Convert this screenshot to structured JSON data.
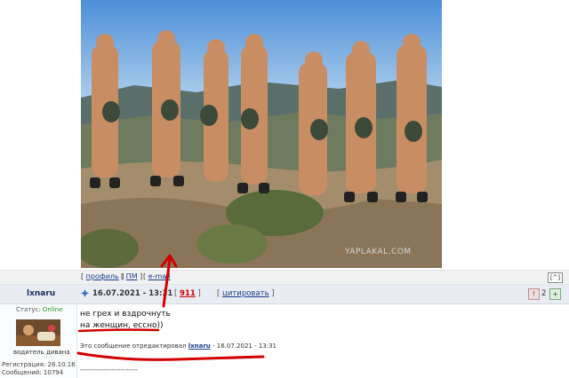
{
  "photo": {
    "watermark": "YAPLAKAL.COM"
  },
  "actions": {
    "profile": "профиль",
    "pm": "ПМ",
    "email": "e-mail",
    "scroll_top": "[^]"
  },
  "post": {
    "username": "lxnaru",
    "date": "16.07.2021 - 13:31",
    "number": "911",
    "quote_label": "цитировать",
    "reply_count": "2",
    "body_lines": [
      "не грех и вздрочнуть",
      "на женщин, ессно))"
    ],
    "edit_prefix": "Это сообщение отредактировал",
    "edit_user": "lxnaru",
    "edit_date": "- 16.07.2021 - 13:31",
    "signature_line": "--------------------"
  },
  "user": {
    "status_label": "Статус:",
    "status_value": "Online",
    "rank": "водитель дивана",
    "registration": "Регистрация: 26.10.16",
    "messages": "Сообщений: 10794"
  },
  "colors": {
    "accent": "#1a3e8a",
    "red_marker": "#d40000",
    "online": "#2a9a2a"
  },
  "icons": [
    "post-marker-icon",
    "alert-icon",
    "plus-icon"
  ]
}
